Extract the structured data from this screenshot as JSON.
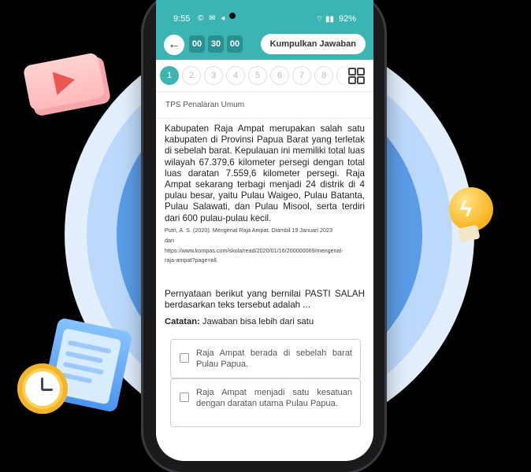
{
  "status_bar": {
    "time": "9:55",
    "app_icons": "© ✉ ◂",
    "network": "⌔ ▮▮",
    "battery": "92%"
  },
  "toolbar": {
    "back_icon": "arrow-left-icon",
    "timer": [
      "00",
      "30",
      "00"
    ],
    "submit_label": "Kumpulkan Jawaban"
  },
  "question_nav": {
    "numbers": [
      "1",
      "2",
      "3",
      "4",
      "5",
      "6",
      "7",
      "8"
    ],
    "active_number": "1",
    "grid_icon": "grid-icon"
  },
  "section_title": "TPS Penalaran Umum",
  "passage": "Kabupaten Raja Ampat merupakan salah satu kabupaten di Provinsi Papua Barat yang terletak di sebelah barat. Kepulauan ini memiliki total luas wilayah 67.379,6 kilometer persegi dengan total luas daratan 7.559,6 kilometer persegi. Raja Ampat sekarang terbagi menjadi 24 distrik di 4 pulau besar, yaitu Pulau Waigeo, Pulau Batanta, Pulau Salawati, dan Pulau Misool, serta terdiri dari 600 pulau-pulau kecil.",
  "citation": {
    "line1": "Putri, A. S. (2020). Mengenal Raja Ampat. Diambil 19 Januari 2023",
    "line2": "dari",
    "line3": "https://www.kompas.com/skola/read/2020/01/16/200000069/mengenal-",
    "line4": "raja-ampat?page=all."
  },
  "question": "Pernyataan berikut yang bernilai PASTI SALAH berdasarkan teks tersebut adalah ...",
  "note": {
    "label": "Catatan:",
    "text": "Jawaban bisa lebih dari satu"
  },
  "options": [
    {
      "text": "Raja Ampat berada di sebelah barat Pulau Papua."
    },
    {
      "text": "Raja Ampat menjadi satu kesatuan dengan daratan utama Pulau Papua."
    }
  ],
  "colors": {
    "brand_teal": "#3cb4b3",
    "timer_bg": "#2a9090",
    "bg_blue": "#5a9ce6"
  },
  "decor": {
    "video_icon": "video-play-icon",
    "bulb_icon": "lightbulb-icon",
    "clipboard_icon": "clipboard-icon",
    "clock_icon": "clock-icon"
  }
}
